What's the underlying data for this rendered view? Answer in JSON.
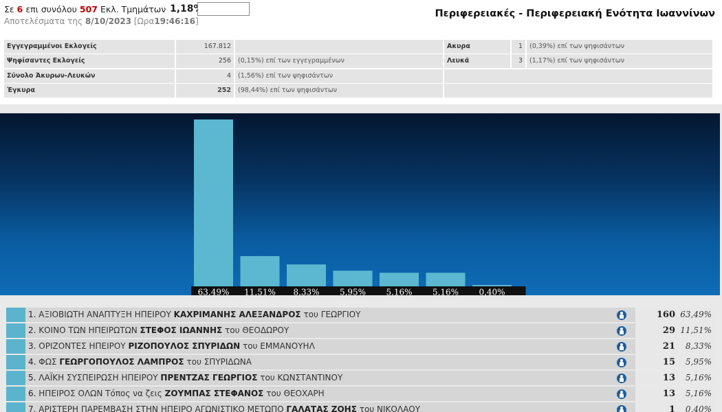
{
  "header": {
    "progress_prefix": "Σε",
    "progress_count": "6",
    "progress_mid": "επι συνόλου",
    "progress_total": "507",
    "progress_suffix": "Εκλ. Τμημάτων",
    "progress_pct": "1,18%",
    "results_prefix": "Αποτελέσματα της",
    "results_date": "8/10/2023",
    "results_time_prefix": "[Ωρα",
    "results_time": "19:46:16",
    "results_time_suffix": "]",
    "region_title": "Περιφερειακές - Περιφερειακή Ενότητα Ιωαννίνων"
  },
  "stats_left": [
    {
      "label": "Εγγεγραμμένοι Εκλογείς",
      "value": "167.812",
      "note": ""
    },
    {
      "label": "Ψηφίσαντες Εκλογείς",
      "value": "256",
      "note": "(0,15%) επί των εγγεγραμμένων"
    },
    {
      "label": "Σύνολο Άκυρων-Λευκών",
      "value": "4",
      "note": "(1,56%) επί των ψηφισάντων"
    },
    {
      "label": "Έγκυρα",
      "value": "252",
      "note": "(98,44%) επί των ψηφισάντων"
    }
  ],
  "stats_right": [
    {
      "label": "Ακυρα",
      "value": "1",
      "note": "(0,39%) επί των ψηφισάντων"
    },
    {
      "label": "Λευκά",
      "value": "3",
      "note": "(1,17%) επί των ψηφισάντων"
    },
    {
      "label": "",
      "value": "",
      "note": ""
    },
    {
      "label": "",
      "value": "",
      "note": ""
    }
  ],
  "chart_data": {
    "type": "bar",
    "categories": [
      "1",
      "2",
      "3",
      "4",
      "5",
      "6",
      "7"
    ],
    "values": [
      63.49,
      11.51,
      8.33,
      5.95,
      5.16,
      5.16,
      0.4
    ],
    "labels": [
      "63,49%",
      "11,51%",
      "8,33%",
      "5,95%",
      "5,16%",
      "5,16%",
      "0,40%"
    ],
    "ylim": [
      0,
      63.49
    ],
    "bar_color": "#5bb8d0",
    "label_bg": "#111111"
  },
  "candidates": [
    {
      "rank": "1.",
      "party": "ΑΞΙΟΒΙΩΤΗ ΑΝΑΠΤΥΞΗ ΗΠΕΙΡΟΥ",
      "name": "ΚΑΧΡΙΜΑΝΗΣ ΑΛΕΞΑΝΔΡΟΣ",
      "father": "του ΓΕΩΡΓΙΟΥ",
      "votes": "160",
      "pct": "63,49%"
    },
    {
      "rank": "2.",
      "party": "ΚΟΙΝΟ ΤΩΝ ΗΠΕΙΡΩΤΩΝ",
      "name": "ΣΤΕΦΟΣ ΙΩΑΝΝΗΣ",
      "father": "του ΘΕΟΔΩΡΟΥ",
      "votes": "29",
      "pct": "11,51%"
    },
    {
      "rank": "3.",
      "party": "ΟΡΙΖΟΝΤΕΣ ΗΠΕΙΡΟΥ",
      "name": "ΡΙΖΟΠΟΥΛΟΣ ΣΠΥΡΙΔΩΝ",
      "father": "του ΕΜΜΑΝΟΥΗΛ",
      "votes": "21",
      "pct": "8,33%"
    },
    {
      "rank": "4.",
      "party": "ΦΩΣ",
      "name": "ΓΕΩΡΓΟΠΟΥΛΟΣ ΛΑΜΠΡΟΣ",
      "father": "του ΣΠΥΡΙΔΩΝΑ",
      "votes": "15",
      "pct": "5,95%"
    },
    {
      "rank": "5.",
      "party": "ΛΑΪΚΗ ΣΥΣΠΕΙΡΩΣΗ ΗΠΕΙΡΟΥ",
      "name": "ΠΡΕΝΤΖΑΣ ΓΕΩΡΓΙΟΣ",
      "father": "του ΚΩΝΣΤΑΝΤΙΝΟΥ",
      "votes": "13",
      "pct": "5,16%"
    },
    {
      "rank": "6.",
      "party": "ΗΠΕΙΡΟΣ ΟΛΩΝ Τόπος να ζεις",
      "name": "ΖΟΥΜΠΑΣ ΣΤΕΦΑΝΟΣ",
      "father": "του ΘΕΟΧΑΡΗ",
      "votes": "13",
      "pct": "5,16%"
    },
    {
      "rank": "7.",
      "party": "ΑΡΙΣΤΕΡΗ ΠΑΡΕΜΒΑΣΗ ΣΤΗΝ ΗΠΕΙΡΟ ΑΓΩΝΙΣΤΙΚΟ ΜΕΤΩΠΟ",
      "name": "ΓΑΛΑΤΑΣ ΖΟΗΣ",
      "father": "του ΝΙΚΟΛΑΟΥ",
      "votes": "1",
      "pct": "0,40%"
    }
  ]
}
